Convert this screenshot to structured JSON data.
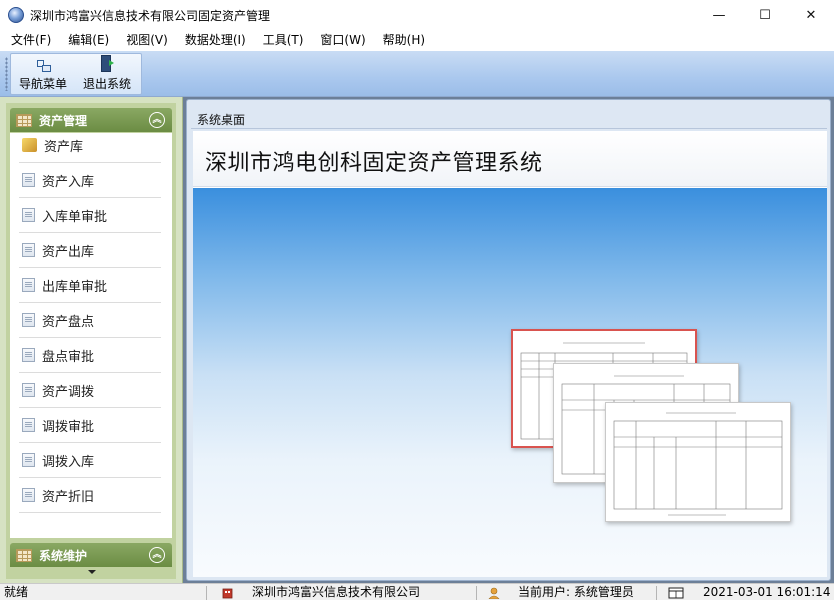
{
  "window": {
    "title": "深圳市鸿富兴信息技术有限公司固定资产管理",
    "minimize": "—",
    "maximize": "☐",
    "close": "✕"
  },
  "menu": [
    {
      "label": "文件(F)"
    },
    {
      "label": "编辑(E)"
    },
    {
      "label": "视图(V)"
    },
    {
      "label": "数据处理(I)"
    },
    {
      "label": "工具(T)"
    },
    {
      "label": "窗口(W)"
    },
    {
      "label": "帮助(H)"
    }
  ],
  "toolbar": {
    "nav_label": "导航菜单",
    "exit_label": "退出系统"
  },
  "sidebar": {
    "group1_title": "资产管理",
    "collapse_glyph": "︽",
    "items": [
      {
        "label": "资产库"
      },
      {
        "label": "资产入库"
      },
      {
        "label": "入库单审批"
      },
      {
        "label": "资产出库"
      },
      {
        "label": "出库单审批"
      },
      {
        "label": "资产盘点"
      },
      {
        "label": "盘点审批"
      },
      {
        "label": "资产调拨"
      },
      {
        "label": "调拨审批"
      },
      {
        "label": "调拨入库"
      },
      {
        "label": "资产折旧"
      }
    ],
    "group2_title": "系统维护"
  },
  "workspace": {
    "tab_label": "系统桌面",
    "title": "深圳市鸿电创科固定资产管理系统"
  },
  "statusbar": {
    "status": "就绪",
    "company": "深圳市鸿富兴信息技术有限公司",
    "user": "当前用户: 系统管理员",
    "datetime": "2021-03-01 16:01:14"
  }
}
